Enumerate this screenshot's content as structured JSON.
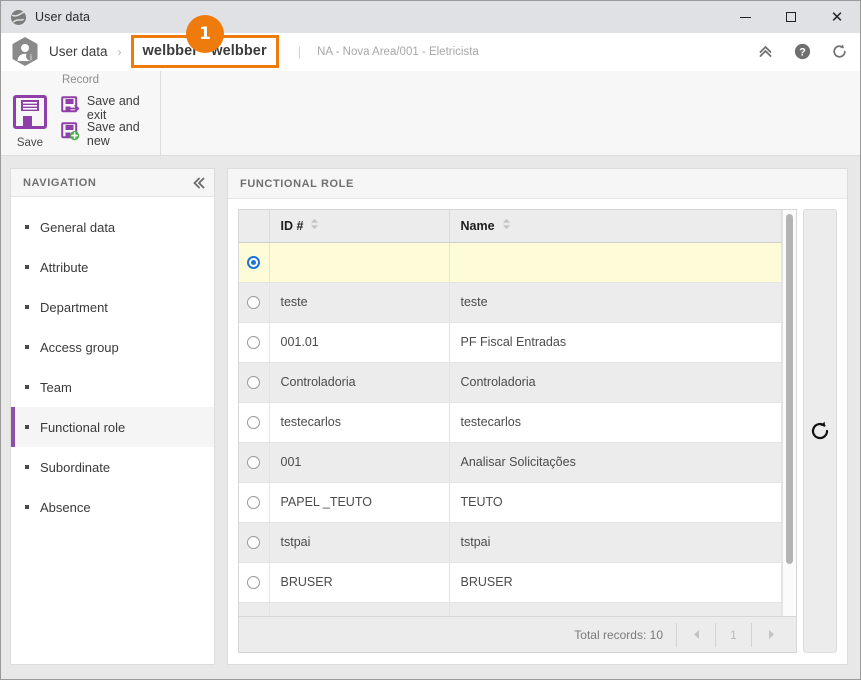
{
  "window": {
    "title": "User data",
    "title_icon": "globe-icon",
    "controls": {
      "minimize": "minimize-icon",
      "maximize": "maximize-icon",
      "close": "close-icon"
    }
  },
  "breadcrumb": {
    "avatar_icon": "user-hexagon-icon",
    "root": "User data",
    "separator": "›",
    "current": "welbber - welbber",
    "pipe": "|",
    "subtitle": "NA - Nova Area/001 - Eletricista",
    "badge": "1",
    "badge_color": "#ee7b0c",
    "highlight_color": "#ee7b0c",
    "actions": [
      {
        "name": "collapse-ribbon-icon",
        "glyph": "chevrons-up"
      },
      {
        "name": "help-icon",
        "glyph": "question-circle"
      },
      {
        "name": "refresh-icon",
        "glyph": "refresh"
      }
    ]
  },
  "ribbon": {
    "group_label": "Record",
    "accent_color": "#8f3fa8",
    "save_label": "Save",
    "save_icon": "floppy-disk-icon",
    "actions": [
      {
        "label": "Save and exit",
        "icon": "save-and-exit-icon"
      },
      {
        "label": "Save and new",
        "icon": "save-and-new-icon"
      }
    ]
  },
  "sidebar": {
    "title": "NAVIGATION",
    "collapse_icon": "chevrons-left-icon",
    "active_index": 5,
    "accent_color": "#8f4ea8",
    "items": [
      {
        "label": "General data"
      },
      {
        "label": "Attribute"
      },
      {
        "label": "Department"
      },
      {
        "label": "Access group"
      },
      {
        "label": "Team"
      },
      {
        "label": "Functional role"
      },
      {
        "label": "Subordinate"
      },
      {
        "label": "Absence"
      }
    ]
  },
  "main": {
    "title": "FUNCTIONAL ROLE",
    "grid": {
      "columns": [
        {
          "key": "select",
          "label": ""
        },
        {
          "key": "id",
          "label": "ID #",
          "sortable": true
        },
        {
          "key": "name",
          "label": "Name",
          "sortable": true
        }
      ],
      "selected_row": 0,
      "rows": [
        {
          "id": "",
          "name": ""
        },
        {
          "id": "teste",
          "name": "teste"
        },
        {
          "id": "001.01",
          "name": "PF Fiscal Entradas"
        },
        {
          "id": "Controladoria",
          "name": "Controladoria"
        },
        {
          "id": "testecarlos",
          "name": "testecarlos"
        },
        {
          "id": "001",
          "name": "Analisar Solicitações"
        },
        {
          "id": "PAPEL _TEUTO",
          "name": "TEUTO"
        },
        {
          "id": "tstpai",
          "name": "tstpai"
        },
        {
          "id": "BRUSER",
          "name": "BRUSER"
        },
        {
          "id": "",
          "name": ""
        }
      ]
    },
    "footer": {
      "total_records": "Total records: 10",
      "prev_label": "◀",
      "page": "1",
      "next_label": "▶"
    },
    "side_tool": {
      "name": "refresh-grid-icon",
      "glyph": "refresh"
    }
  }
}
